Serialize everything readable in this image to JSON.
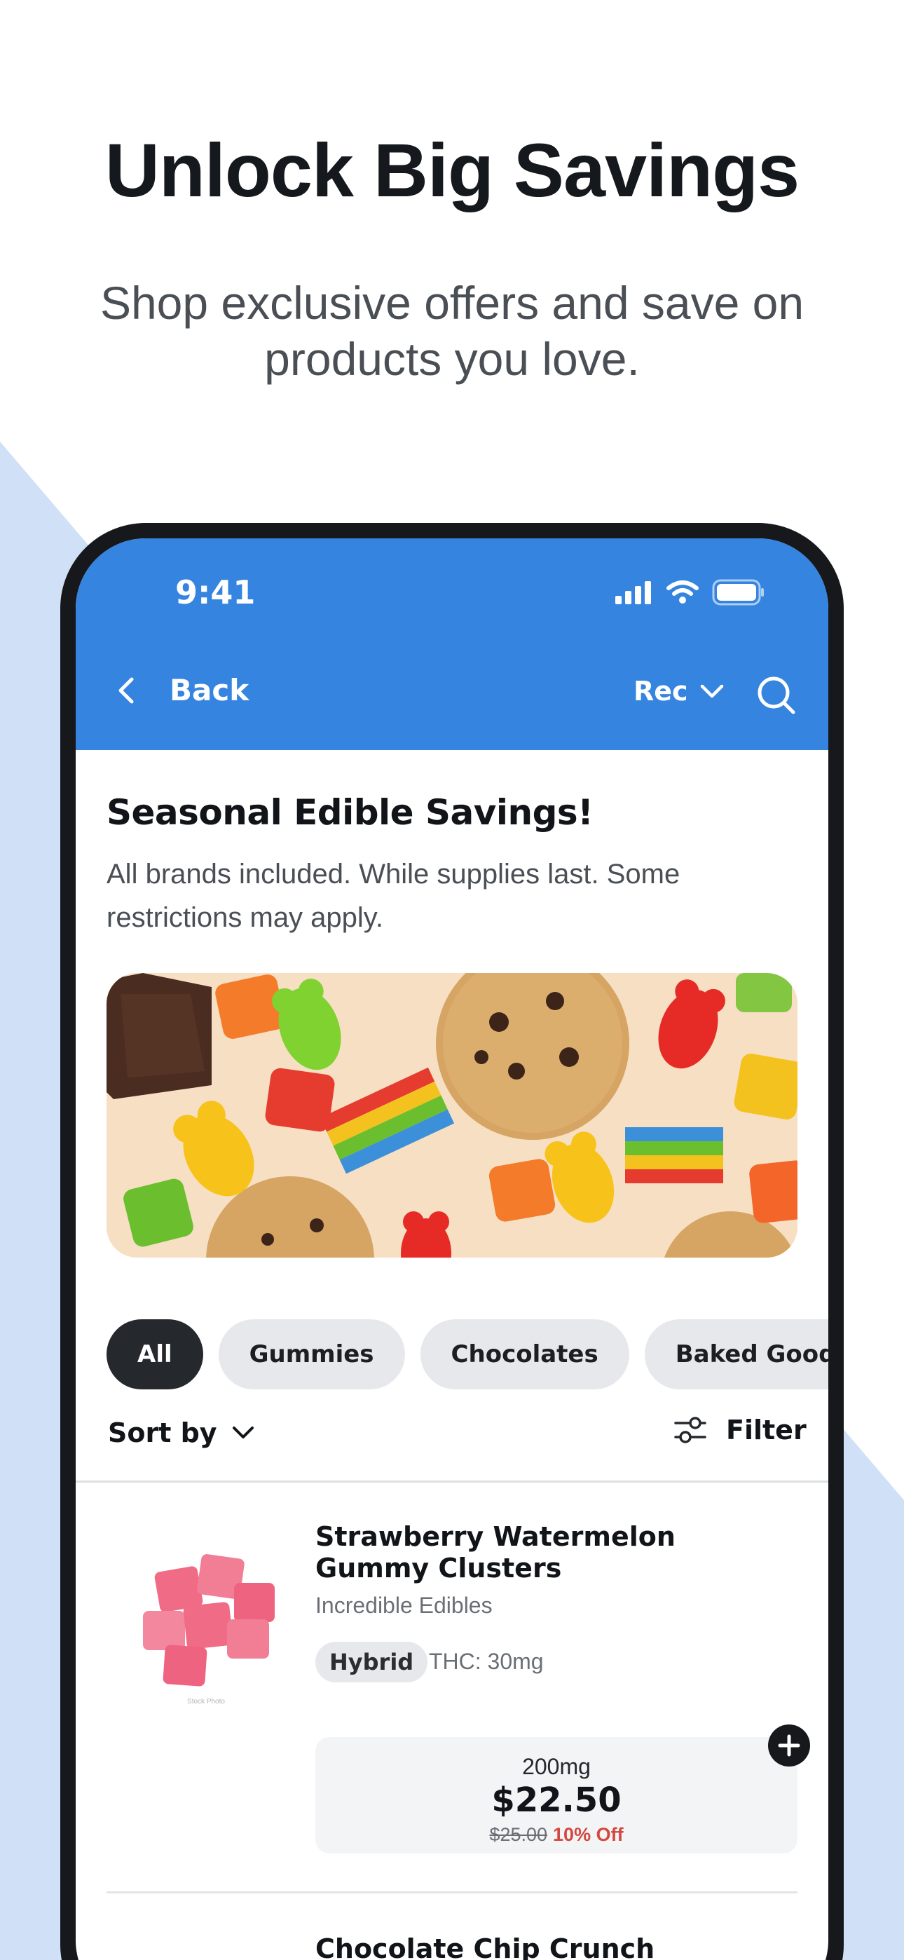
{
  "marketing": {
    "headline": "Unlock Big Savings",
    "subheadline": "Shop exclusive offers and save on products you love."
  },
  "status_bar": {
    "time": "9:41"
  },
  "nav": {
    "back_label": "Back",
    "menu_type": "Rec"
  },
  "promo": {
    "title": "Seasonal Edible Savings!",
    "description": "All brands included. While supplies last. Some restrictions may apply."
  },
  "categories": [
    {
      "label": "All",
      "active": true
    },
    {
      "label": "Gummies",
      "active": false
    },
    {
      "label": "Chocolates",
      "active": false
    },
    {
      "label": "Baked Goods",
      "active": false
    }
  ],
  "toolbar": {
    "sort_label": "Sort by",
    "filter_label": "Filter"
  },
  "products": [
    {
      "name": "Strawberry Watermelon Gummy Clusters",
      "brand": "Incredible Edibles",
      "strain": "Hybrid",
      "thc": "THC: 30mg",
      "weight": "200mg",
      "price": "$22.50",
      "original_price": "$25.00",
      "discount": "10% Off",
      "image_caption": "Stock Photo"
    },
    {
      "name": "Chocolate Chip Crunch"
    }
  ],
  "colors": {
    "accent_blue": "#3584e0",
    "background_shape": "#cfe0f7",
    "discount_red": "#d4483f",
    "chip_active": "#25282c",
    "chip_inactive": "#e6e8eb"
  }
}
